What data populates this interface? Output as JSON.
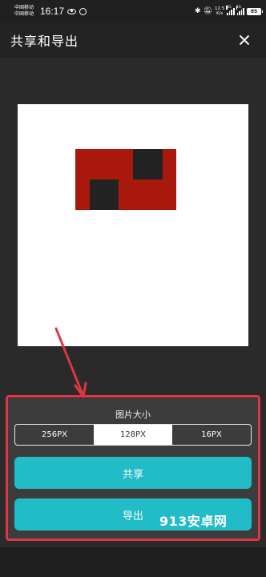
{
  "status_bar": {
    "carrier1": "中国移动",
    "carrier2": "中国移动",
    "time": "16:17",
    "speed_value": "12.5",
    "speed_unit": "K/s",
    "sig1_label": "4G",
    "sig2_label": "4G",
    "battery": "85"
  },
  "header": {
    "title": "共享和导出"
  },
  "export_panel": {
    "size_label": "图片大小",
    "size_options": [
      "256PX",
      "128PX",
      "16PX"
    ],
    "selected_size": "128PX",
    "share_label": "共享",
    "export_label": "导出"
  },
  "watermark": "913安卓网",
  "colors": {
    "accent": "#21bcc7",
    "annotation": "#dc3545",
    "pixel_red": "#a8180c",
    "pixel_dark": "#222222"
  }
}
